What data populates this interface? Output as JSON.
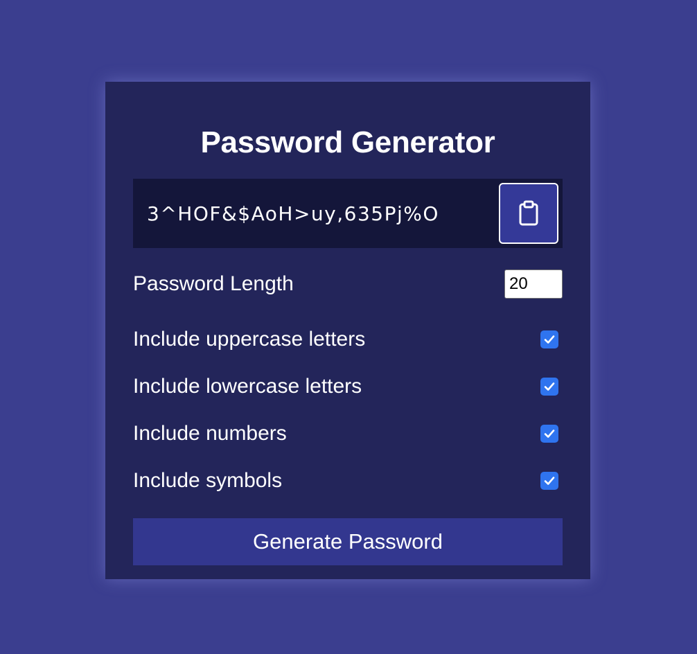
{
  "app": {
    "title": "Password Generator"
  },
  "result": {
    "password": "3^HOF&$AoH>uy,635Pj%O",
    "copy_icon": "clipboard-icon"
  },
  "settings": {
    "length": {
      "label": "Password Length",
      "value": "20"
    },
    "uppercase": {
      "label": "Include uppercase letters",
      "checked": true
    },
    "lowercase": {
      "label": "Include lowercase letters",
      "checked": true
    },
    "numbers": {
      "label": "Include numbers",
      "checked": true
    },
    "symbols": {
      "label": "Include symbols",
      "checked": true
    }
  },
  "generate": {
    "label": "Generate Password"
  },
  "colors": {
    "background": "#3b3e8f",
    "card": "#23255a",
    "result_bg": "#14163a",
    "accent": "#343998",
    "checkbox": "#2f74ef"
  }
}
